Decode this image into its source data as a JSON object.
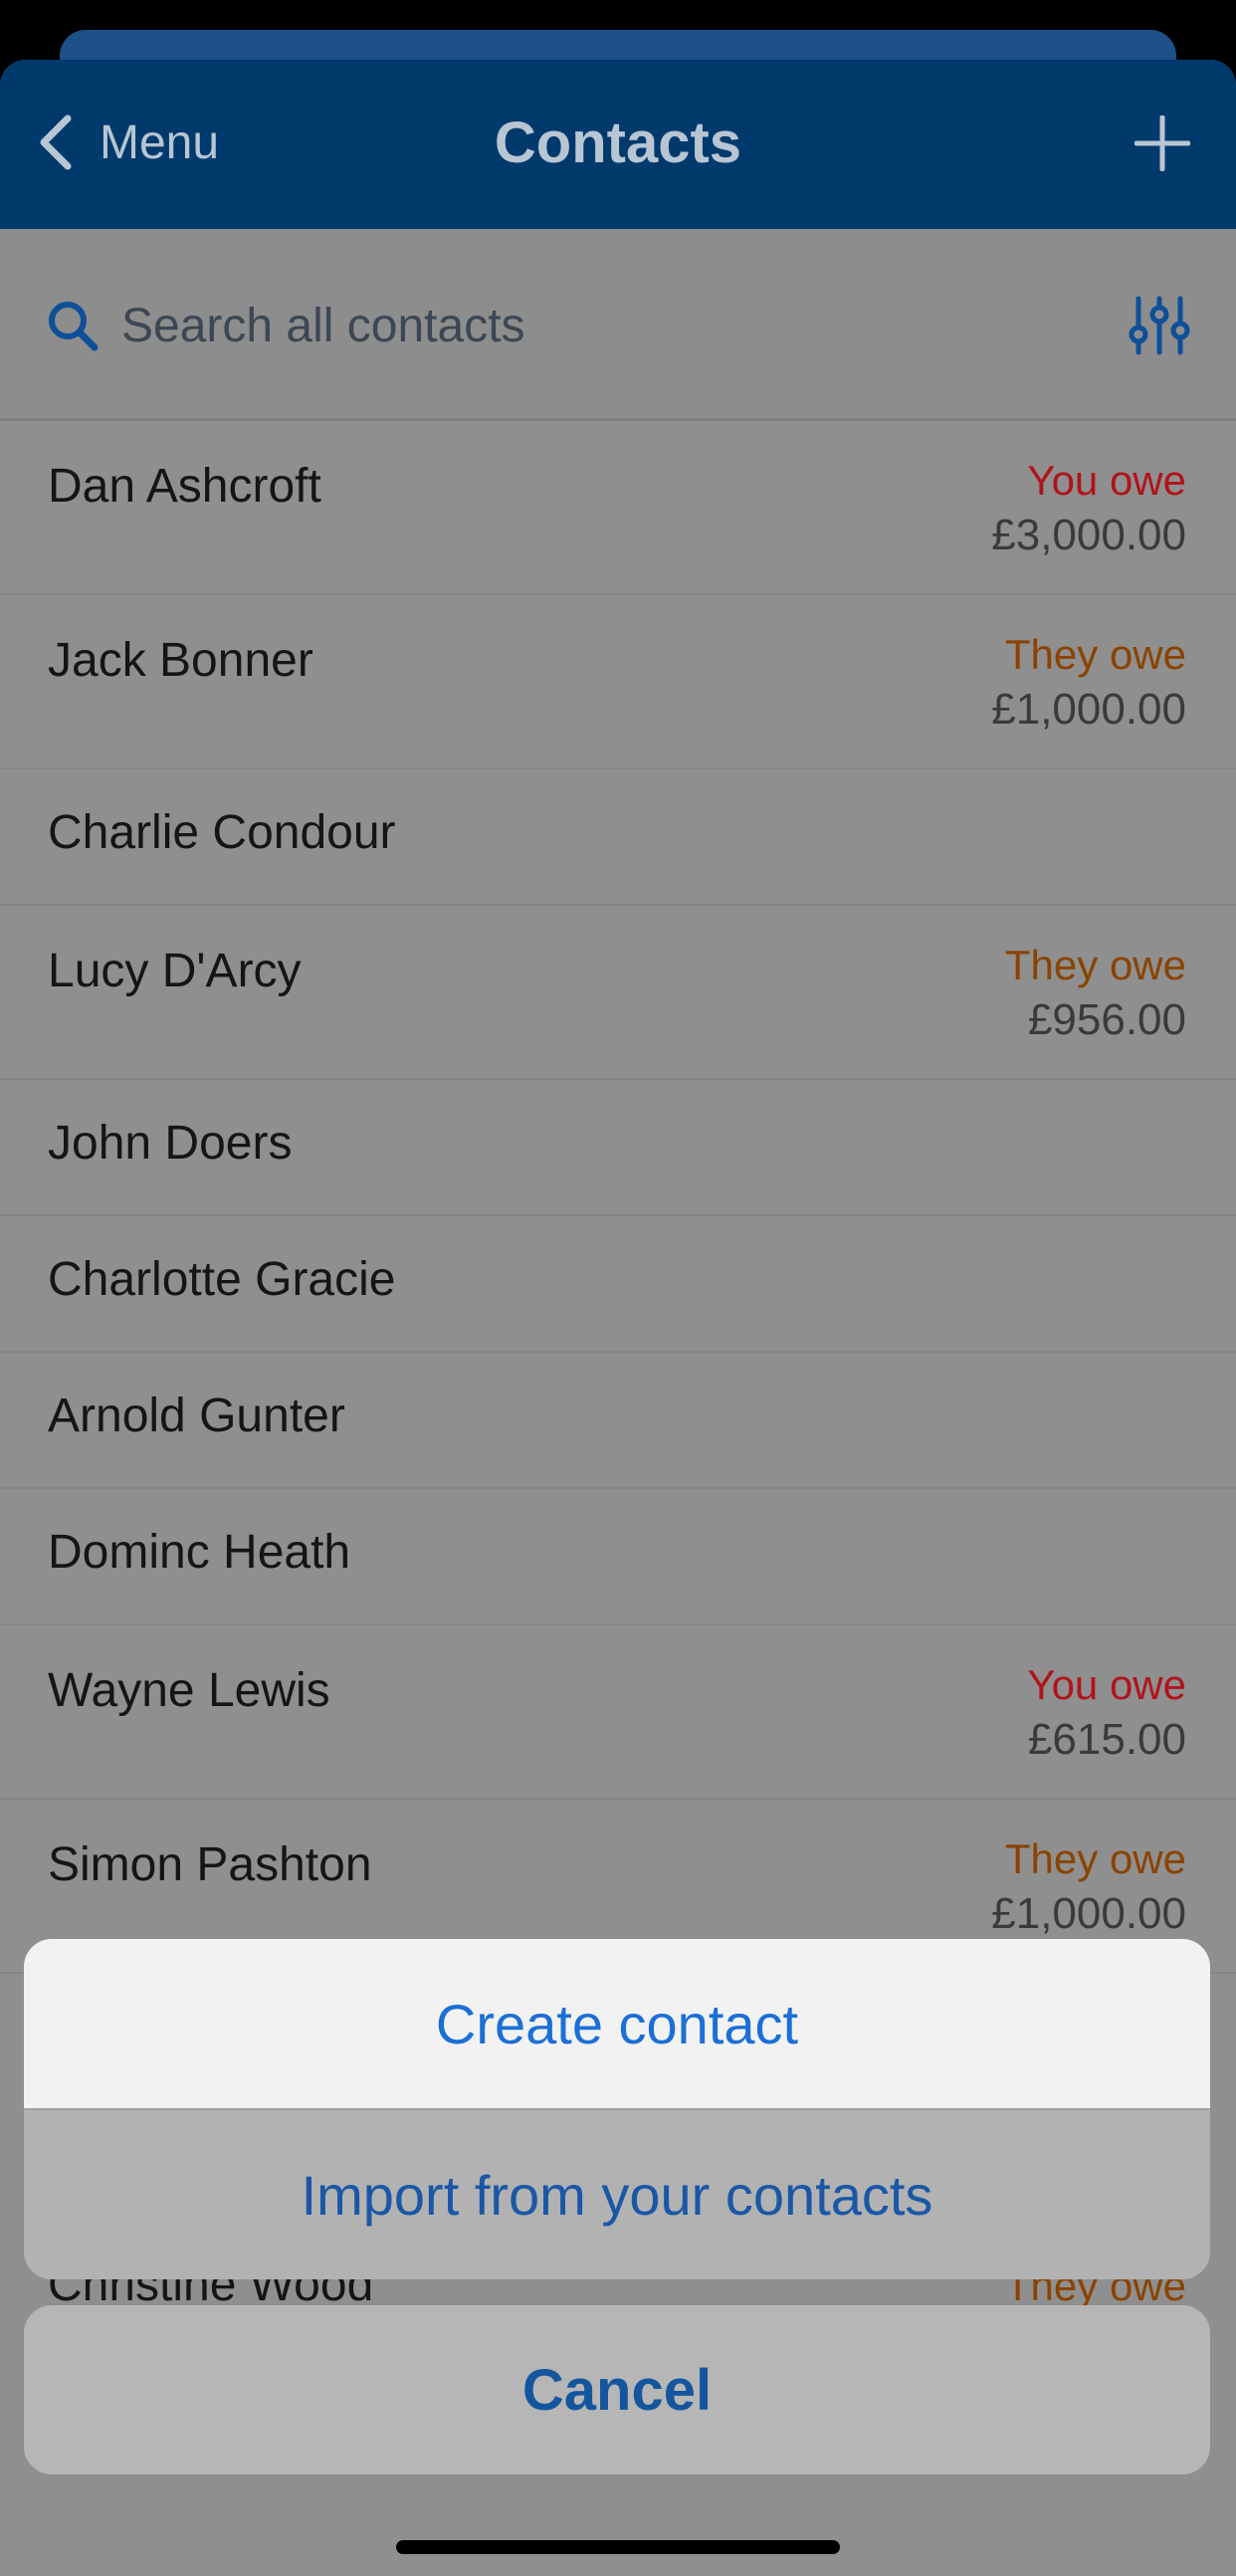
{
  "nav": {
    "back_label": "Menu",
    "title": "Contacts"
  },
  "search": {
    "placeholder": "Search all contacts"
  },
  "contacts": [
    {
      "name": "Dan Ashcroft",
      "status": "You owe",
      "amount": "£3,000.00"
    },
    {
      "name": "Jack Bonner",
      "status": "They owe",
      "amount": "£1,000.00"
    },
    {
      "name": "Charlie Condour"
    },
    {
      "name": "Lucy D'Arcy",
      "status": "They owe",
      "amount": "£956.00"
    },
    {
      "name": "John Doers"
    },
    {
      "name": "Charlotte Gracie"
    },
    {
      "name": "Arnold Gunter"
    },
    {
      "name": "Dominc Heath"
    },
    {
      "name": "Wayne Lewis",
      "status": "You owe",
      "amount": "£615.00"
    },
    {
      "name": "Simon Pashton",
      "status": "They owe",
      "amount": "£1,000.00"
    }
  ],
  "peek": {
    "name": "Christine Wood",
    "status": "They owe"
  },
  "action_sheet": {
    "create_label": "Create contact",
    "import_label": "Import from your contacts",
    "cancel_label": "Cancel"
  },
  "colors": {
    "nav_bg": "#003a6c",
    "you_owe": "#b0141a",
    "they_owe": "#8a4300",
    "action_blue": "#1b6fd6"
  }
}
